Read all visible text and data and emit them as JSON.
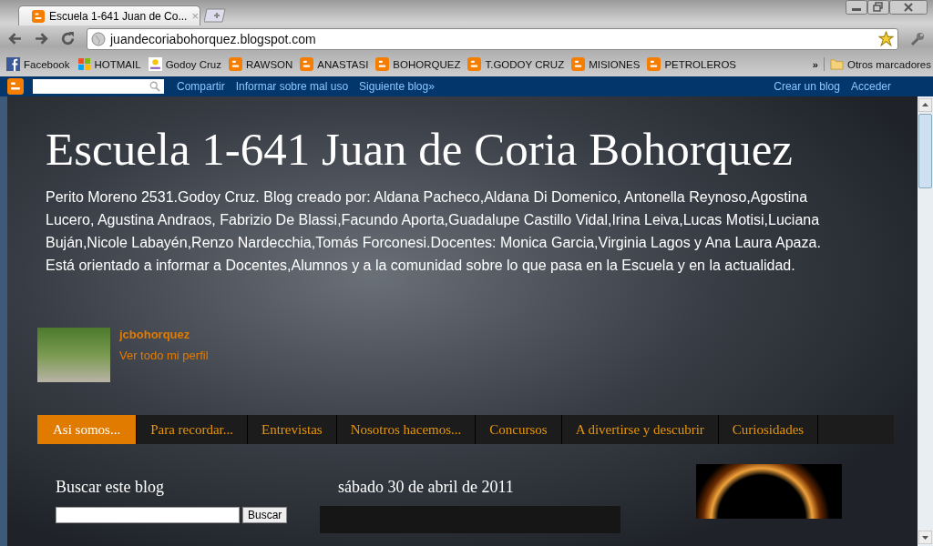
{
  "browser": {
    "tab": {
      "title": "Escuela 1-641 Juan de Co...",
      "close": "×"
    },
    "address": "juandecoriabohorquez.blogspot.com",
    "bookmarks": [
      {
        "label": "Facebook",
        "kind": "facebook"
      },
      {
        "label": "HOTMAIL",
        "kind": "windows"
      },
      {
        "label": "Godoy Cruz",
        "kind": "site"
      },
      {
        "label": "RAWSON",
        "kind": "blogger"
      },
      {
        "label": "ANASTASI",
        "kind": "blogger"
      },
      {
        "label": "BOHORQUEZ",
        "kind": "blogger"
      },
      {
        "label": "T.GODOY CRUZ",
        "kind": "blogger"
      },
      {
        "label": "MISIONES",
        "kind": "blogger"
      },
      {
        "label": "PETROLEROS",
        "kind": "blogger"
      }
    ],
    "more": "»",
    "other_bookmarks": "Otros marcadores"
  },
  "navbar": {
    "left_links": [
      "Compartir",
      "Informar sobre mal uso",
      "Siguiente blog»"
    ],
    "right_links": [
      "Crear un blog",
      "Acceder"
    ]
  },
  "blog": {
    "title": "Escuela 1-641 Juan de Coria Bohorquez",
    "description": "Perito Moreno 2531.Godoy Cruz. Blog creado por: Aldana Pacheco,Aldana Di Domenico, Antonella Reynoso,Agostina Lucero, Agustina Andraos, Fabrizio De Blassi,Facundo Aporta,Guadalupe Castillo Vidal,Irina Leiva,Lucas Motisi,Luciana Buján,Nicole Labayén,Renzo Nardecchia,Tomás Forconesi.Docentes: Monica Garcia,Virginia Lagos y Ana Laura Apaza. Está orientado a informar a Docentes,Alumnos y a la comunidad sobre lo que pasa en la Escuela y en la actualidad.",
    "profile": {
      "name": "jcbohorquez",
      "link": "Ver todo mi perfil"
    },
    "tabs": [
      {
        "label": "Asi somos...",
        "selected": true
      },
      {
        "label": "Para recordar...",
        "selected": false
      },
      {
        "label": "Entrevistas",
        "selected": false
      },
      {
        "label": "Nosotros hacemos...",
        "selected": false
      },
      {
        "label": "Concursos",
        "selected": false
      },
      {
        "label": "A divertirse y descubrir",
        "selected": false
      },
      {
        "label": "Curiosidades",
        "selected": false
      }
    ],
    "sidebar": {
      "heading": "Buscar este blog",
      "button": "Buscar"
    },
    "post": {
      "date": "sábado 30 de abril de 2011"
    }
  }
}
